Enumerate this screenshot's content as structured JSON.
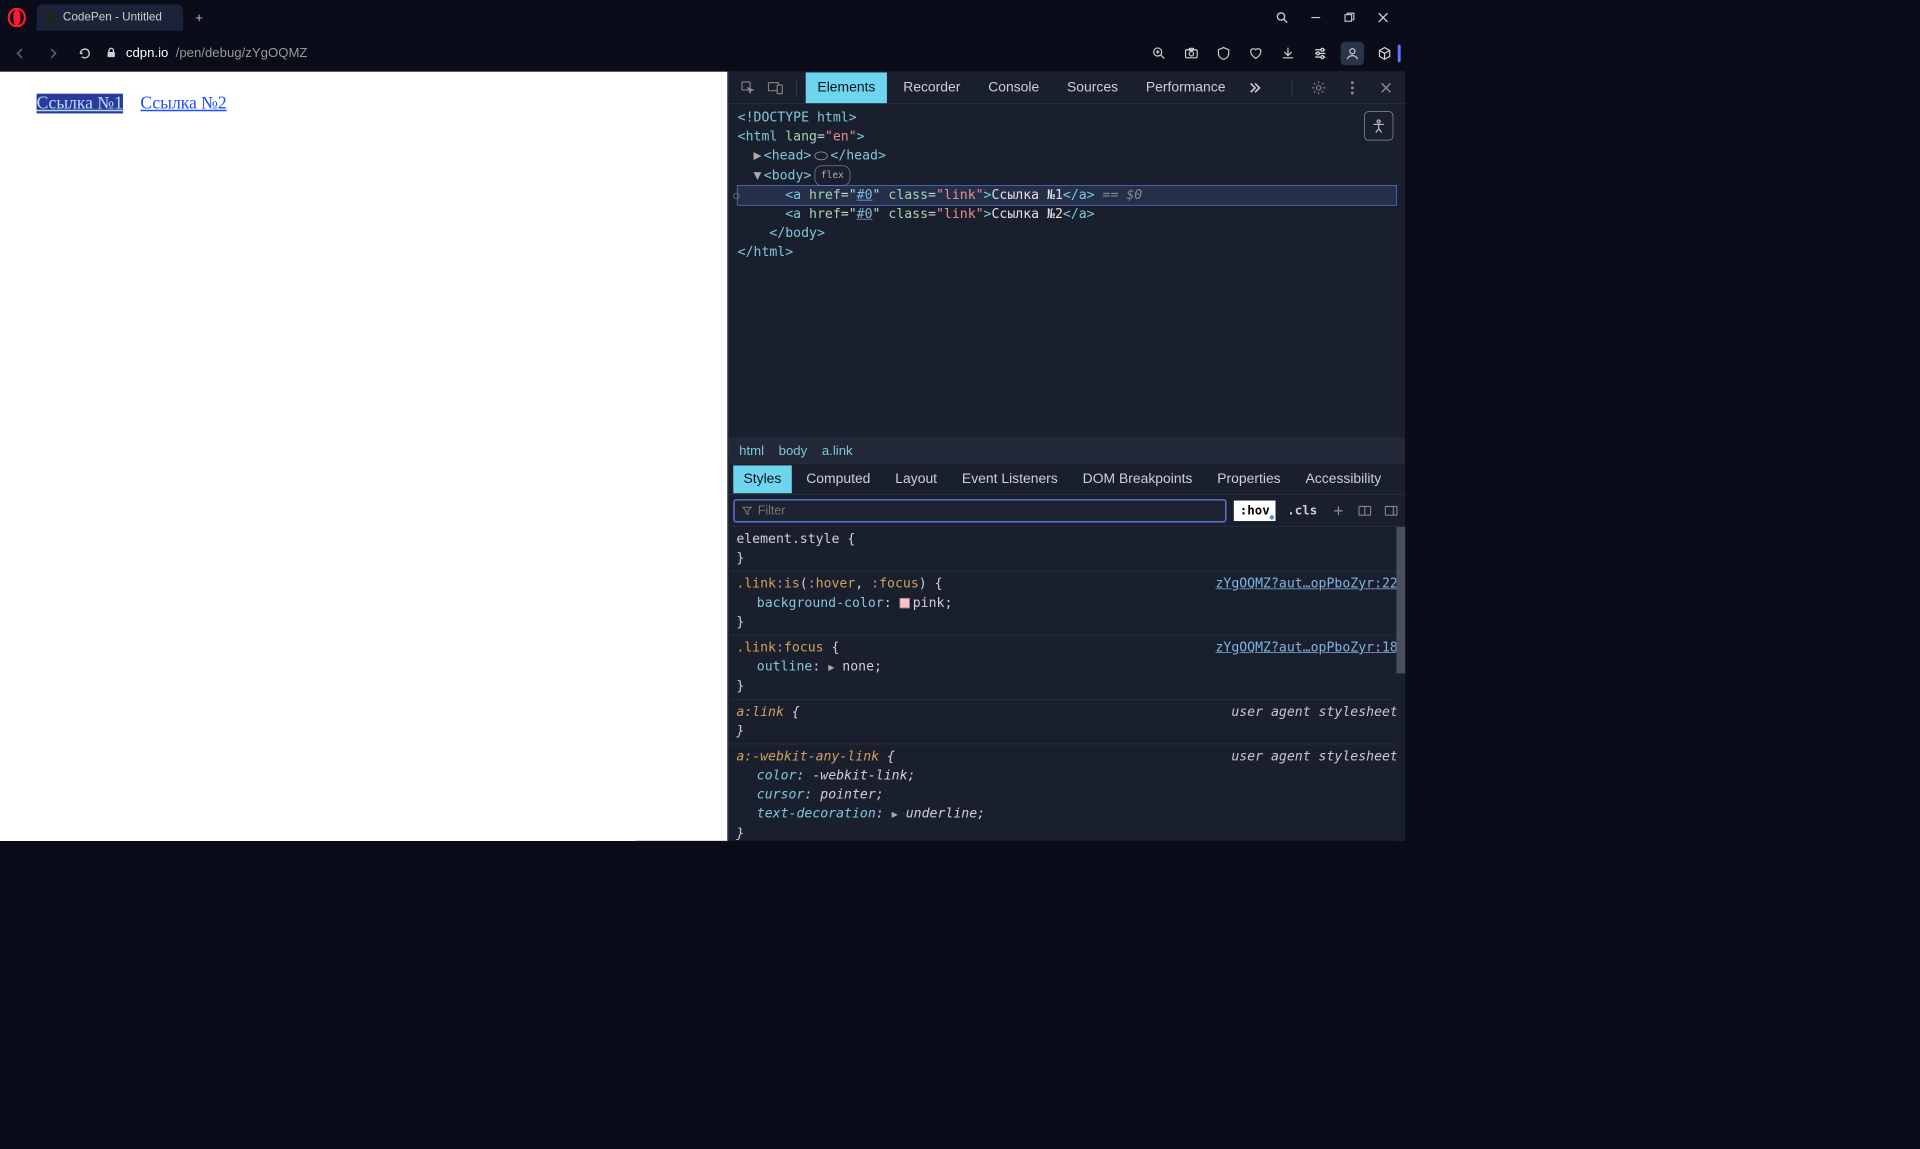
{
  "titlebar": {
    "tab_title": "CodePen - Untitled",
    "new_tab_plus": "+"
  },
  "addressbar": {
    "domain": "cdpn.io",
    "path": "/pen/debug/zYgOQMZ"
  },
  "page": {
    "link1": "Ссылка №1",
    "link2": "Ссылка №2"
  },
  "devtools": {
    "tabs": {
      "elements": "Elements",
      "recorder": "Recorder",
      "console": "Console",
      "sources": "Sources",
      "performance": "Performance"
    },
    "dom": {
      "doctype": "<!DOCTYPE html>",
      "html_open": "<html lang=\"en\">",
      "head_open_label": "<head>",
      "head_close": "</head>",
      "body_open": "<body>",
      "body_badge": "flex",
      "a1_pre": "<a href=\"",
      "a_href": "#0",
      "a1_mid": "\" class=\"link\">",
      "a1_text": "Ссылка №1",
      "a_close": "</a>",
      "a1_suffix": " == $0",
      "a2_text": "Ссылка №2",
      "body_close": "</body>",
      "html_close": "</html>"
    },
    "breadcrumb": {
      "p1": "html",
      "p2": "body",
      "p3": "a.link"
    },
    "styles_tabs": {
      "styles": "Styles",
      "computed": "Computed",
      "layout": "Layout",
      "event_listeners": "Event Listeners",
      "dom_breakpoints": "DOM Breakpoints",
      "properties": "Properties",
      "accessibility": "Accessibility"
    },
    "filter": {
      "placeholder": "Filter",
      "hov": ":hov",
      "cls": ".cls"
    },
    "rules": {
      "element_style": "element.style {",
      "r1_sel": ".link:is(:hover, :focus) {",
      "r1_src": "zYgOQMZ?aut…opPboZyr:22",
      "r1_prop_name": "background-color",
      "r1_prop_val": "pink",
      "r2_sel": ".link:focus {",
      "r2_src": "zYgOQMZ?aut…opPboZyr:18",
      "r2_prop_name": "outline",
      "r2_prop_val": "none",
      "r3_sel": "a:link {",
      "ua_label": "user agent stylesheet",
      "r4_sel": "a:-webkit-any-link {",
      "r4_p1_name": "color",
      "r4_p1_val": "-webkit-link",
      "r4_p2_name": "cursor",
      "r4_p2_val": "pointer",
      "r4_p3_name": "text-decoration",
      "r4_p3_val": "underline",
      "close_brace": "}"
    }
  }
}
